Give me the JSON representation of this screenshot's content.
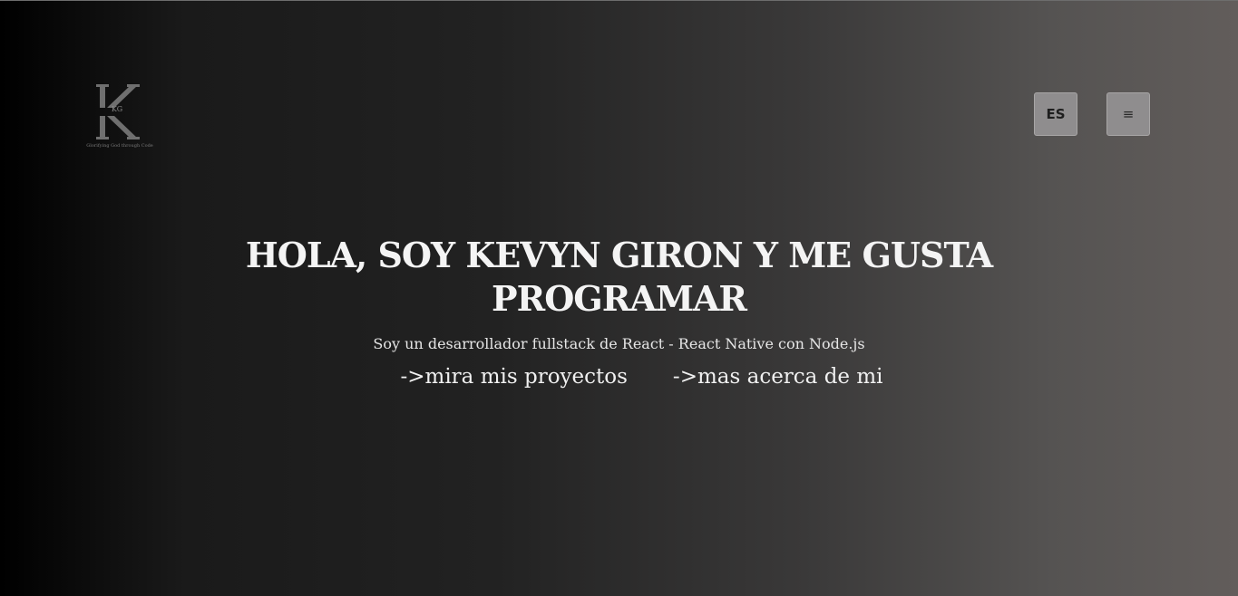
{
  "logo": {
    "monogram": "KG",
    "tagline": "Glorifying God through Code"
  },
  "header": {
    "language_label": "ES",
    "menu_icon": "hamburger-menu-icon",
    "menu_glyph": "≡"
  },
  "hero": {
    "title": "HOLA, SOY KEVYN GIRON Y ME GUSTA PROGRAMAR",
    "subtitle": "Soy un desarrollador fullstack de React - React Native con Node.js",
    "links": [
      {
        "label": "->mira mis proyectos"
      },
      {
        "label": "->mas acerca de mi"
      }
    ]
  },
  "colors": {
    "background_start": "#000000",
    "background_end": "#625d5b",
    "button_bg": "#8f8d8e",
    "text": "#f2f2f2"
  }
}
